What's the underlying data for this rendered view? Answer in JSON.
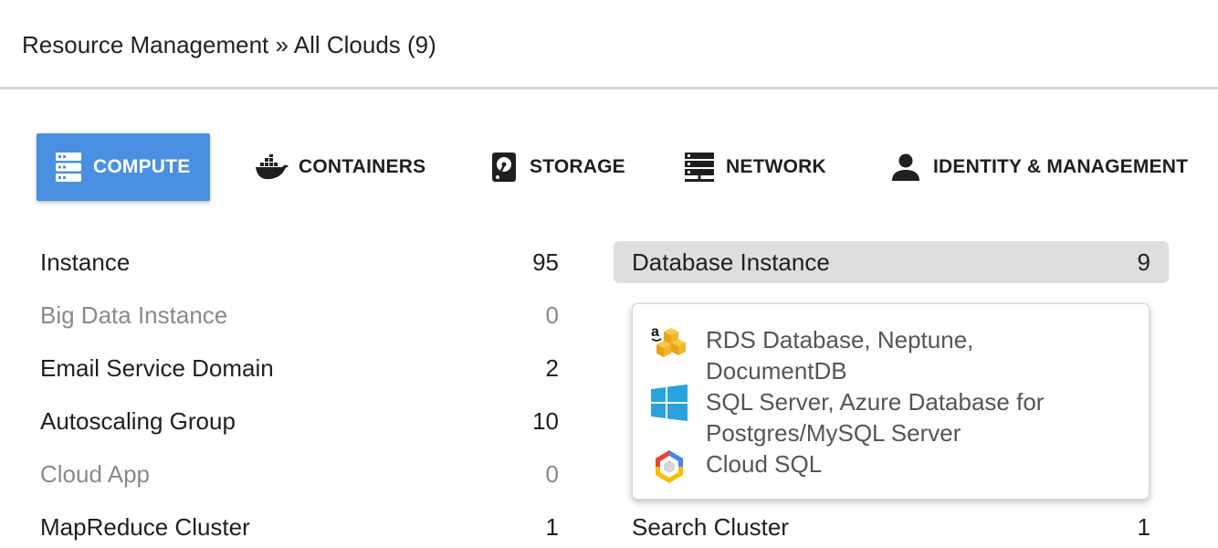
{
  "breadcrumb": "Resource Management » All Clouds (9)",
  "colors": {
    "accent": "#4a90e2",
    "highlight_row": "#dedede",
    "dim_text": "#8a8a8a"
  },
  "tabs": [
    {
      "label": "COMPUTE",
      "icon": "server-list-icon",
      "active": true
    },
    {
      "label": "CONTAINERS",
      "icon": "docker-whale-icon",
      "active": false
    },
    {
      "label": "STORAGE",
      "icon": "hard-drive-icon",
      "active": false
    },
    {
      "label": "NETWORK",
      "icon": "network-server-icon",
      "active": false
    },
    {
      "label": "IDENTITY & MANAGEMENT",
      "icon": "user-icon",
      "active": false
    }
  ],
  "left_list": [
    {
      "label": "Instance",
      "count": "95"
    },
    {
      "label": "Big Data Instance",
      "count": "0"
    },
    {
      "label": "Email Service Domain",
      "count": "2"
    },
    {
      "label": "Autoscaling Group",
      "count": "10"
    },
    {
      "label": "Cloud App",
      "count": "0"
    },
    {
      "label": "MapReduce Cluster",
      "count": "1"
    }
  ],
  "right_list": [
    {
      "label": "Database Instance",
      "count": "9"
    },
    {
      "label": "Search Cluster",
      "count": "1"
    }
  ],
  "popover": {
    "items": [
      {
        "icon": "aws-icon",
        "text": "RDS Database, Neptune, DocumentDB"
      },
      {
        "icon": "azure-windows-icon",
        "text": "SQL Server, Azure Database for Postgres/MySQL Server"
      },
      {
        "icon": "google-cloud-icon",
        "text": "Cloud SQL"
      }
    ]
  }
}
